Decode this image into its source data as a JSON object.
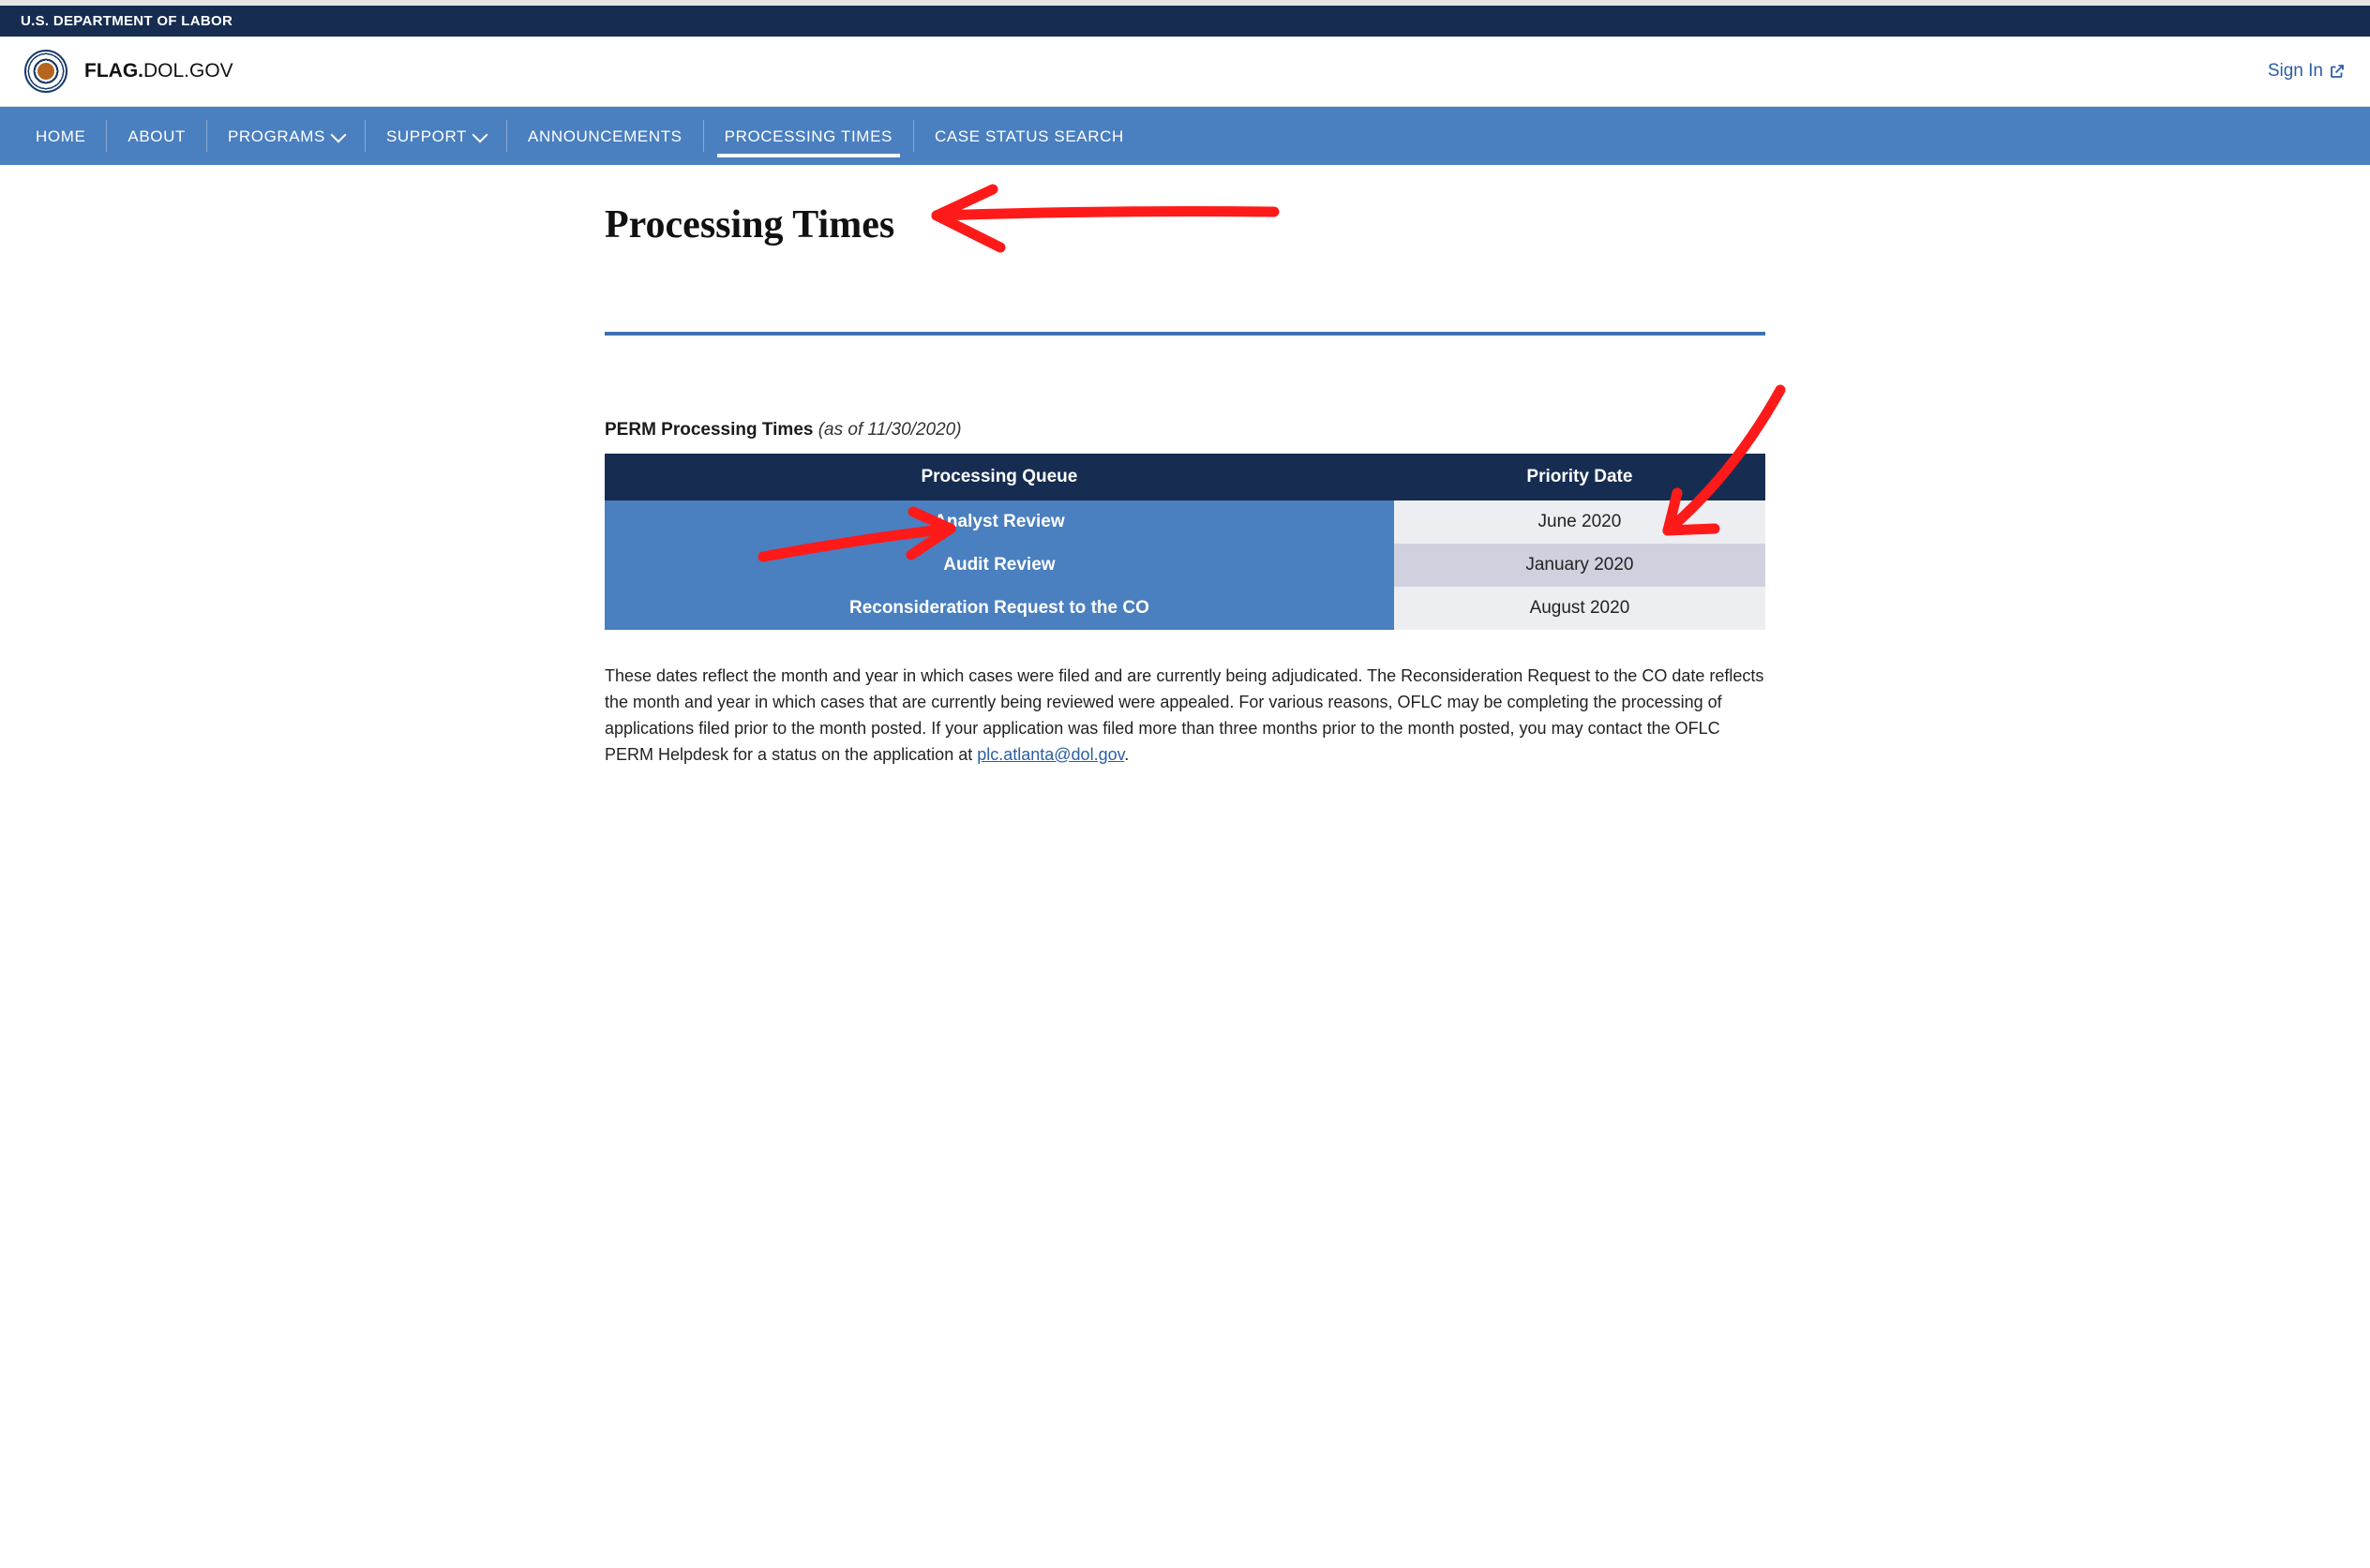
{
  "dept_bar": "U.S. DEPARTMENT OF LABOR",
  "brand": {
    "bold": "FLAG.",
    "rest": "DOL.GOV"
  },
  "signin_label": "Sign In",
  "nav": {
    "home": "HOME",
    "about": "ABOUT",
    "programs": "PROGRAMS",
    "support": "SUPPORT",
    "announcements": "ANNOUNCEMENTS",
    "processing_times": "PROCESSING TIMES",
    "case_status": "CASE STATUS SEARCH"
  },
  "page_title": "Processing Times",
  "section": {
    "title_bold": "PERM Processing Times",
    "title_italic": "(as of 11/30/2020)"
  },
  "table": {
    "head_queue": "Processing Queue",
    "head_date": "Priority Date",
    "rows": [
      {
        "queue": "Analyst Review",
        "date": "June 2020"
      },
      {
        "queue": "Audit Review",
        "date": "January 2020"
      },
      {
        "queue": "Reconsideration Request to the CO",
        "date": "August 2020"
      }
    ]
  },
  "note_text": "These dates reflect the month and year in which cases were filed and are currently being adjudicated. The Reconsideration Request to the CO date reflects the month and year in which cases that are currently being reviewed were appealed. For various reasons, OFLC may be completing the processing of applications filed prior to the month posted. If your application was filed more than three months prior to the month posted, you may contact the OFLC PERM Helpdesk for a status on the application at ",
  "note_link": "plc.atlanta@dol.gov",
  "note_after": "."
}
